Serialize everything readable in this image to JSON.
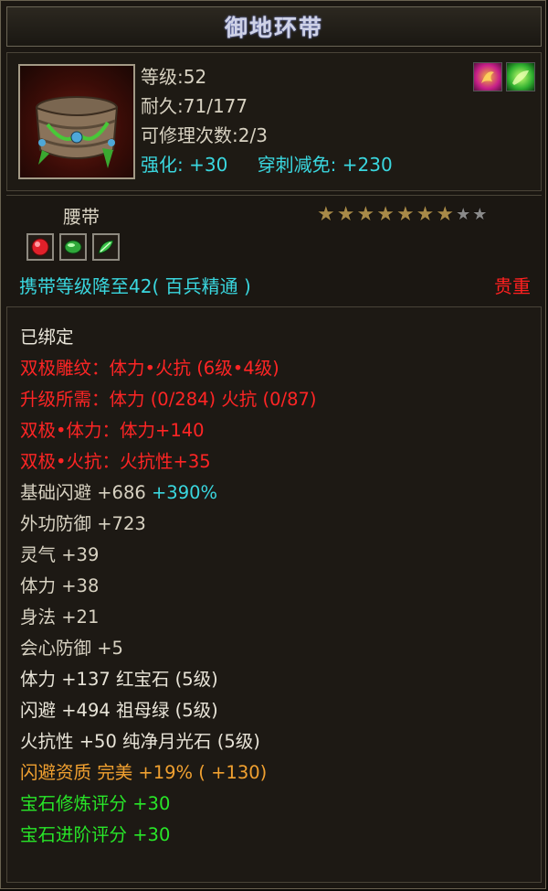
{
  "title": "御地环带",
  "item": {
    "level_label": "等级:",
    "level": "52",
    "durability_label": "耐久:",
    "durability": "71/177",
    "repair_label": "可修理次数:",
    "repair": "2/3",
    "enhance_label": "强化:",
    "enhance": "+30",
    "pierce_label": "穿刺减免:",
    "pierce": "+230",
    "icon": "belt-icon",
    "skill_icons": [
      "fire-rune-icon",
      "nature-rune-icon"
    ]
  },
  "type": "腰带",
  "stars": {
    "filled": 7,
    "total": 9
  },
  "gems": [
    {
      "icon": "red-gem-icon",
      "color": "#e0202a"
    },
    {
      "icon": "green-gem-icon",
      "color": "#2fa83a"
    },
    {
      "icon": "green-leaf-gem-icon",
      "color": "#3cc44a"
    }
  ],
  "carry_text": "携带等级降至42( 百兵精通 )",
  "rarity": "贵重",
  "attributes": [
    {
      "text": "已绑定",
      "color": "white"
    },
    {
      "text": "双极雕纹：体力•火抗 (6级•4级)",
      "color": "red"
    },
    {
      "text": "升级所需：体力 (0/284)  火抗 (0/87)",
      "color": "red"
    },
    {
      "text": "双极•体力：体力+140",
      "color": "red"
    },
    {
      "text": "双极•火抗：火抗性+35",
      "color": "red"
    },
    {
      "text": "基础闪避 +686",
      "color": "beige",
      "extra": " +390%",
      "extra_color": "cyan"
    },
    {
      "text": "外功防御 +723",
      "color": "beige"
    },
    {
      "text": "灵气 +39",
      "color": "beige"
    },
    {
      "text": "体力 +38",
      "color": "beige"
    },
    {
      "text": "身法 +21",
      "color": "beige"
    },
    {
      "text": "会心防御 +5",
      "color": "beige"
    },
    {
      "text": "体力 +137 红宝石 (5级)",
      "color": "white"
    },
    {
      "text": "闪避 +494 祖母绿 (5级)",
      "color": "white"
    },
    {
      "text": "火抗性 +50 纯净月光石 (5级)",
      "color": "white"
    },
    {
      "text": "闪避资质  完美 +19% ( +130)",
      "color": "orange"
    },
    {
      "text": "宝石修炼评分 +30",
      "color": "green"
    },
    {
      "text": "宝石进阶评分 +30",
      "color": "green"
    }
  ]
}
